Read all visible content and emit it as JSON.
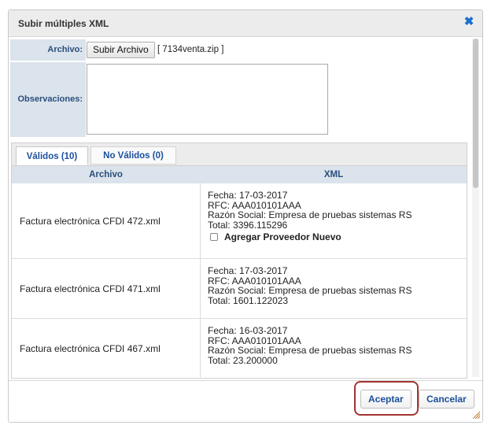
{
  "dialog": {
    "title": "Subir múltiples XML",
    "close_icon": "close-icon"
  },
  "form": {
    "archivo_label": "Archivo:",
    "upload_button": "Subir Archivo",
    "file_name": "[ 7134venta.zip ]",
    "observaciones_label": "Observaciones:",
    "observaciones_value": ""
  },
  "tabs": [
    {
      "label": "Válidos (10)",
      "active": true
    },
    {
      "label": "No Válidos (0)",
      "active": false
    }
  ],
  "table": {
    "headers": [
      "Archivo",
      "XML"
    ],
    "rows": [
      {
        "archivo": "Factura electrónica CFDI 472.xml",
        "fecha": "Fecha: 17-03-2017",
        "rfc": "RFC: AAA010101AAA",
        "razon": "Razón Social: Empresa de pruebas sistemas RS",
        "total": "Total: 3396.115296",
        "checkbox_label": "Agregar Proveedor Nuevo"
      },
      {
        "archivo": "Factura electrónica CFDI 471.xml",
        "fecha": "Fecha: 17-03-2017",
        "rfc": "RFC: AAA010101AAA",
        "razon": "Razón Social: Empresa de pruebas sistemas RS",
        "total": "Total: 1601.122023"
      },
      {
        "archivo": "Factura electrónica CFDI 467.xml",
        "fecha": "Fecha: 16-03-2017",
        "rfc": "RFC: AAA010101AAA",
        "razon": "Razón Social: Empresa de pruebas sistemas RS",
        "total": "Total: 23.200000"
      }
    ]
  },
  "buttons": {
    "aceptar": "Aceptar",
    "cancelar": "Cancelar"
  },
  "colors": {
    "accent": "#1a4f9c",
    "label_bg": "#dbe3ec",
    "highlight": "#a33532"
  }
}
